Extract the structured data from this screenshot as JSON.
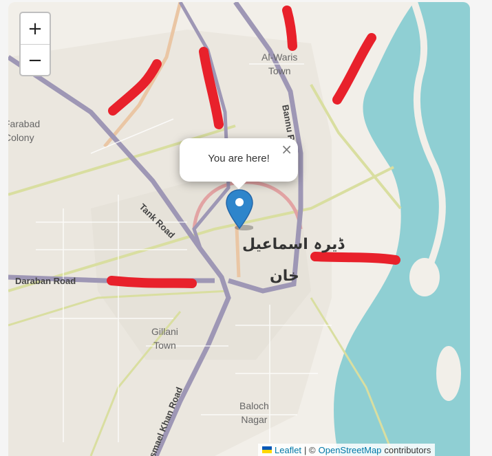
{
  "zoom": {
    "in_label": "+",
    "out_label": "−"
  },
  "popup": {
    "text": "You are here!",
    "close_label": "×"
  },
  "place_labels": {
    "al_waris": "Al-Waris\nTown",
    "farabad": "Farabad\nColony",
    "gillani": "Gillani\nTown",
    "baloch": "Baloch\nNagar",
    "city_line1": "ڈیرہ اسماعیل",
    "city_line2": "خان"
  },
  "road_labels": {
    "tank_road": "Tank Road",
    "bannu_road": "Bannu Road",
    "daraban_road": "Daraban Road",
    "ismail_khan_road": "Ismael Khan Road"
  },
  "attribution": {
    "leaflet": "Leaflet",
    "separator": "| ©",
    "osm": "OpenStreetMap",
    "contributors": "contributors"
  },
  "colors": {
    "land": "#f2efe9",
    "urban": "#e8e4dc",
    "water": "#8fcfd3",
    "primary_road": "#9e97b5",
    "secondary_road": "#d8dca0",
    "marker": "#2e85cb",
    "annotation": "#e8212b"
  }
}
